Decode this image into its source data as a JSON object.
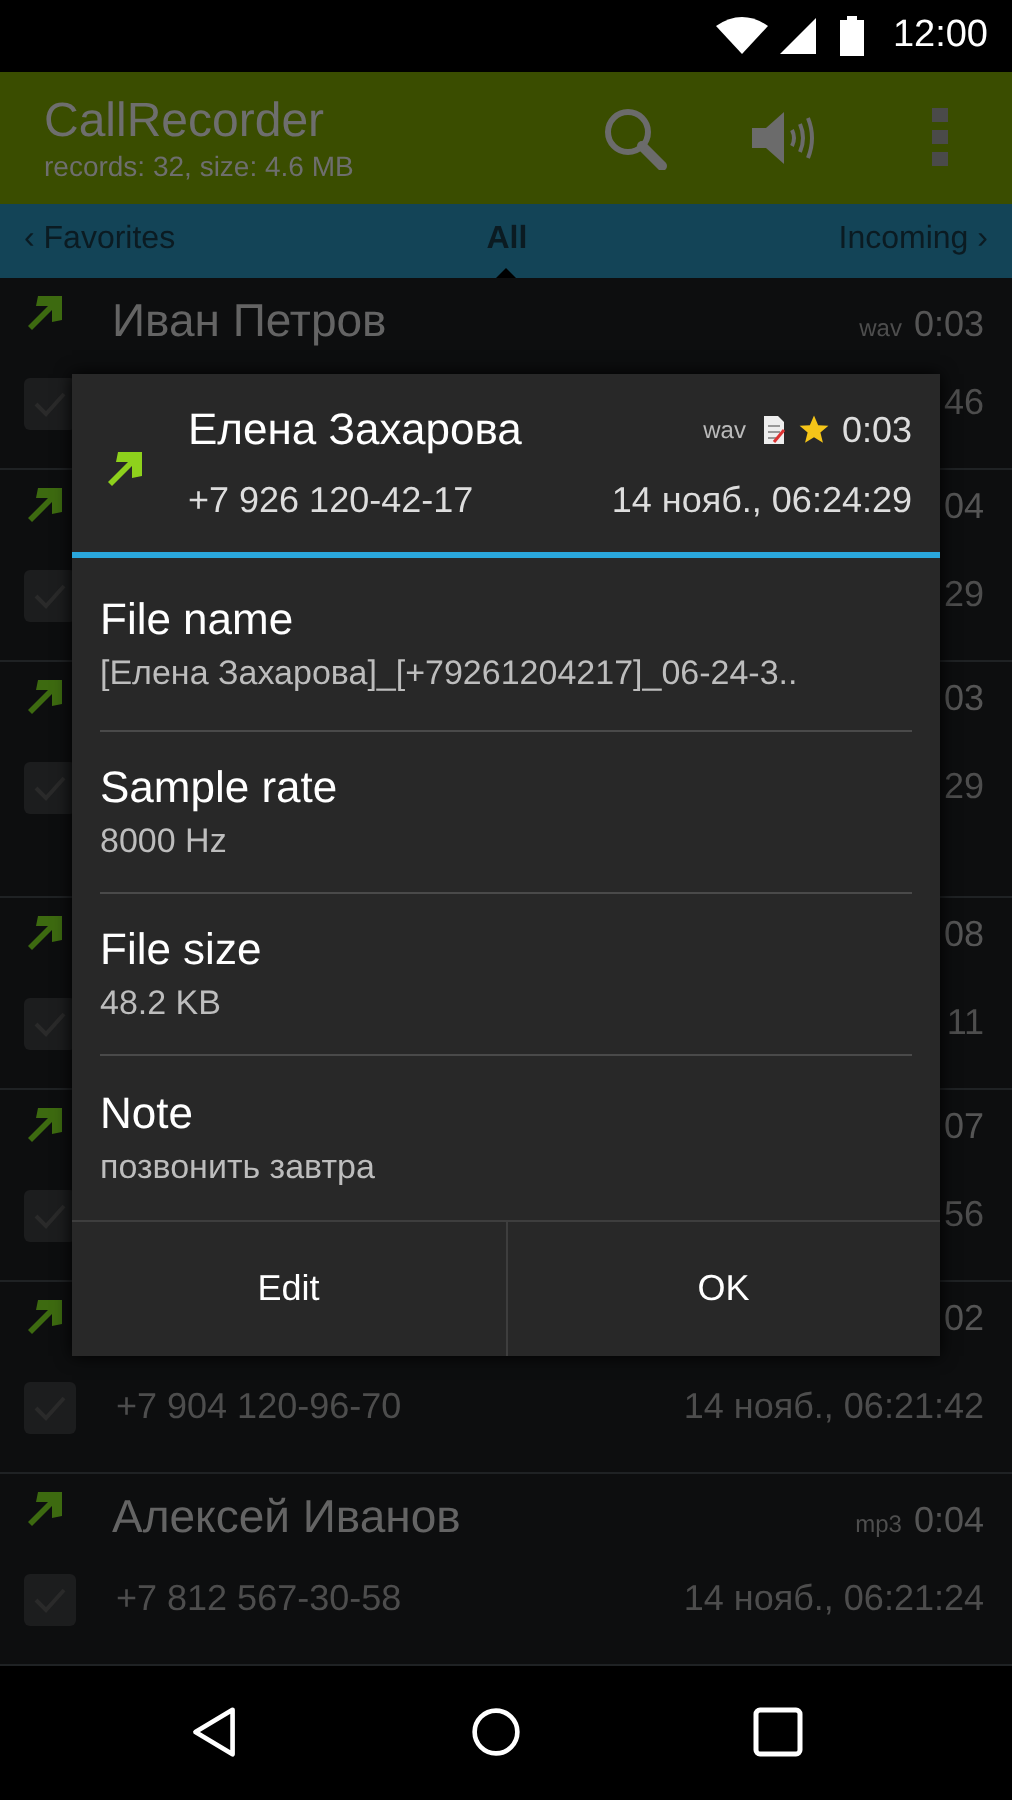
{
  "status_bar": {
    "time": "12:00"
  },
  "app_bar": {
    "title": "CallRecorder",
    "subtitle": "records: 32, size: 4.6 MB"
  },
  "tabs": [
    {
      "label": "‹ Favorites",
      "selected": false
    },
    {
      "label": "All",
      "selected": true
    },
    {
      "label": "Incoming ›",
      "selected": false
    }
  ],
  "recordings": [
    {
      "name": "Иван Петров",
      "format": "wav",
      "duration": "0:03",
      "datetime": "46",
      "tall": false,
      "checked": false
    },
    {
      "duration": "04",
      "datetime": "29",
      "tall": false,
      "checked": false
    },
    {
      "duration": "03",
      "datetime": "29",
      "tall": true,
      "checked": false
    },
    {
      "duration": "08",
      "datetime": "11",
      "tall": false,
      "checked": false
    },
    {
      "duration": "07",
      "datetime": "56",
      "tall": false,
      "checked": false
    },
    {
      "duration": "02",
      "phone": "+7 904 120-96-70",
      "datetime": "14 нояб., 06:21:42",
      "tall": false,
      "checked": false
    },
    {
      "name": "Алексей Иванов",
      "format": "mp3",
      "duration": "0:04",
      "phone": "+7 812 567-30-58",
      "datetime": "14 нояб., 06:21:24",
      "tall": false,
      "checked": false
    }
  ],
  "dialog": {
    "name": "Елена Захарова",
    "format": "wav",
    "favorite": true,
    "duration": "0:03",
    "phone": "+7 926 120-42-17",
    "datetime": "14 нояб., 06:24:29",
    "fields": [
      {
        "label": "File name",
        "value": "[Елена Захарова]_[+79261204217]_06-24-3.."
      },
      {
        "label": "Sample rate",
        "value": "8000 Hz"
      },
      {
        "label": "File size",
        "value": "48.2 KB"
      },
      {
        "label": "Note",
        "value": "позвонить завтра"
      }
    ],
    "buttons": [
      "Edit",
      "OK"
    ]
  }
}
